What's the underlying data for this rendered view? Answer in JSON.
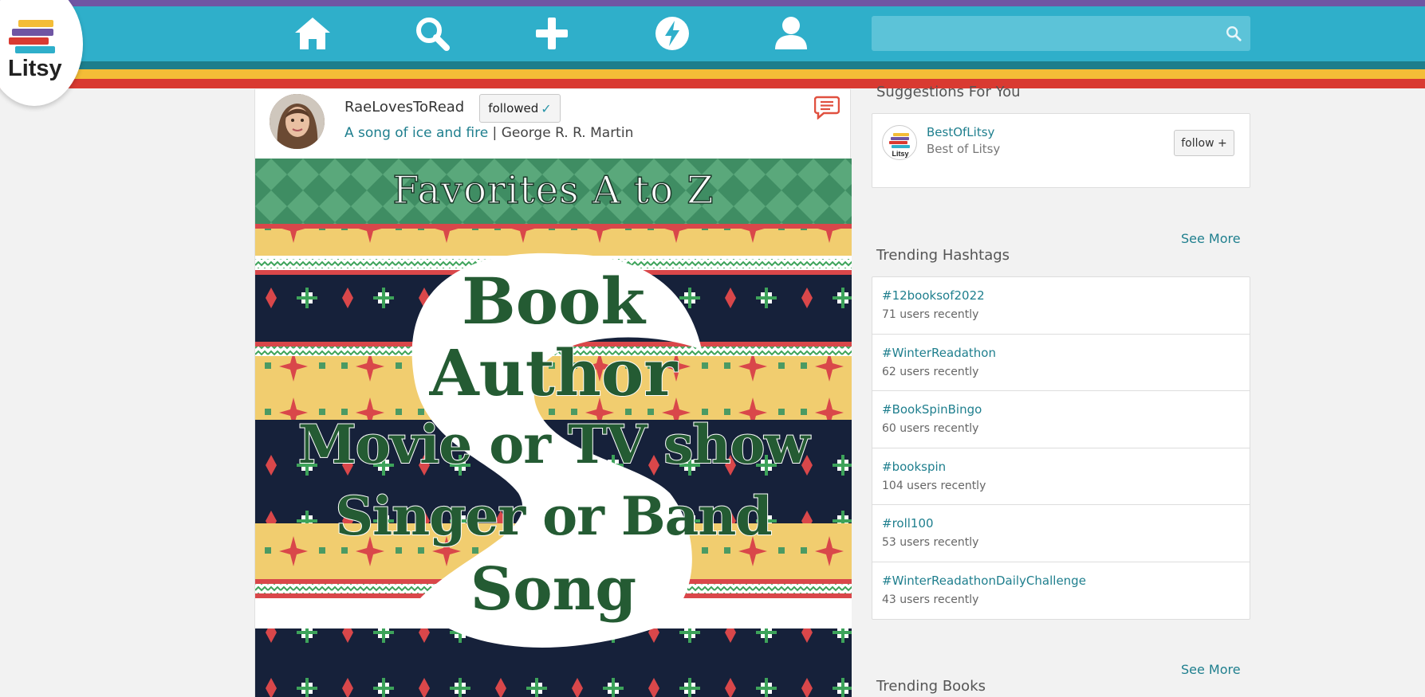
{
  "app": {
    "logo_text": "Litsy"
  },
  "nav": {
    "items": [
      {
        "name": "home",
        "icon": "home-icon"
      },
      {
        "name": "search",
        "icon": "search-icon"
      },
      {
        "name": "add",
        "icon": "plus-icon"
      },
      {
        "name": "activity",
        "icon": "lightning-icon"
      },
      {
        "name": "profile",
        "icon": "user-icon"
      }
    ],
    "search_placeholder": ""
  },
  "post": {
    "username": "RaeLovesToRead",
    "follow_label": "followed",
    "follow_check": "✓",
    "book_title": "A song of ice and fire",
    "separator": " | ",
    "book_author": "George R. R. Martin",
    "image": {
      "title": "Favorites A to Z",
      "lines": [
        "Book",
        "Author",
        "Movie or TV show",
        "Singer or Band",
        "Song"
      ]
    }
  },
  "sidebar": {
    "suggestions": {
      "title": "Suggestions For You",
      "items": [
        {
          "name": "BestOfLitsy",
          "subtitle": "Best of Litsy",
          "button": "follow +"
        }
      ]
    },
    "trending_hashtags": {
      "see_more": "See More",
      "title": "Trending Hashtags",
      "items": [
        {
          "tag": "#12booksof2022",
          "count": "71 users recently"
        },
        {
          "tag": "#WinterReadathon",
          "count": "62 users recently"
        },
        {
          "tag": "#BookSpinBingo",
          "count": "60 users recently"
        },
        {
          "tag": "#bookspin",
          "count": "104 users recently"
        },
        {
          "tag": "#roll100",
          "count": "53 users recently"
        },
        {
          "tag": "#WinterReadathonDailyChallenge",
          "count": "43 users recently"
        }
      ]
    },
    "trending_books": {
      "see_more": "See More",
      "title": "Trending Books"
    }
  },
  "colors": {
    "purple": "#6f55a3",
    "teal": "#2fafca",
    "dark_teal": "#1d7e8c",
    "yellow": "#f4bd37",
    "red": "#d93a31",
    "link": "#1f7f8e"
  }
}
